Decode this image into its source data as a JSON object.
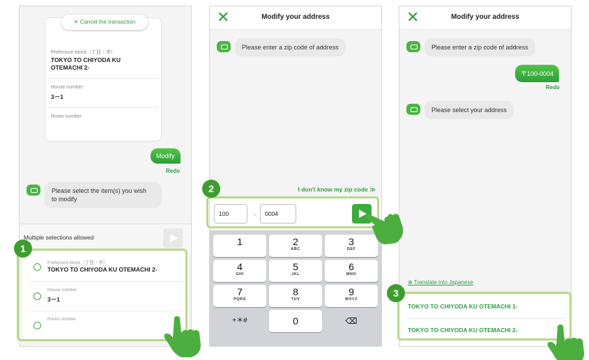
{
  "panel1": {
    "cancel_label": "✕ Cancel the transaction",
    "fields": [
      {
        "label": "Prefecture-block（丁目・字）",
        "value1": "TOKYO TO CHIYODA KU",
        "value2": "OTEMACHI 2-"
      },
      {
        "label": "House number",
        "value1": "3－1"
      },
      {
        "label": "Room number"
      }
    ],
    "modify_label": "Modify",
    "redo_label": "Redo",
    "prompt_line1": "Please select the item(s) you wish",
    "prompt_line2": "to modify",
    "multi_label": "Multiple selections allowed",
    "options": [
      {
        "label": "Prefecture-block（丁目・字）",
        "value": "TOKYO TO CHIYODA KU OTEMACHI 2-"
      },
      {
        "label": "House number",
        "value": "3－1"
      },
      {
        "label": "Room number",
        "value": ""
      }
    ],
    "step": "1"
  },
  "panel2": {
    "close_icon": "✕",
    "title": "Modify your address",
    "message": "Please enter a zip code of address",
    "dont_know": "I don't know my zip code ≫",
    "zip1": "100",
    "dash": "–",
    "zip2": "0004",
    "step": "2",
    "keys": [
      {
        "n": "1",
        "s": ""
      },
      {
        "n": "2",
        "s": "ABC"
      },
      {
        "n": "3",
        "s": "DEF"
      },
      {
        "n": "4",
        "s": "GHI"
      },
      {
        "n": "5",
        "s": "JKL"
      },
      {
        "n": "6",
        "s": "MNO"
      },
      {
        "n": "7",
        "s": "PQRS"
      },
      {
        "n": "8",
        "s": "TUV"
      },
      {
        "n": "9",
        "s": "WXYZ"
      },
      {
        "n": "+＊#",
        "s": ""
      },
      {
        "n": "0",
        "s": ""
      },
      {
        "n": "⌫",
        "s": ""
      }
    ]
  },
  "panel3": {
    "close_icon": "✕",
    "title": "Modify your address",
    "message1": "Please enter a zip code of address",
    "zip_reply": "〒100-0004",
    "redo_label": "Redo",
    "message2": "Please select your address",
    "translate": "⊕ Translate into Japanese",
    "results": [
      "TOKYO TO CHIYODA KU OTEMACHI 1-",
      "TOKYO TO CHIYODA KU OTEMACHI 2-"
    ],
    "step": "3"
  },
  "colors": {
    "brand_green": "#3caa3c",
    "highlight": "#b8d98a",
    "badge": "#3d9e2f"
  }
}
